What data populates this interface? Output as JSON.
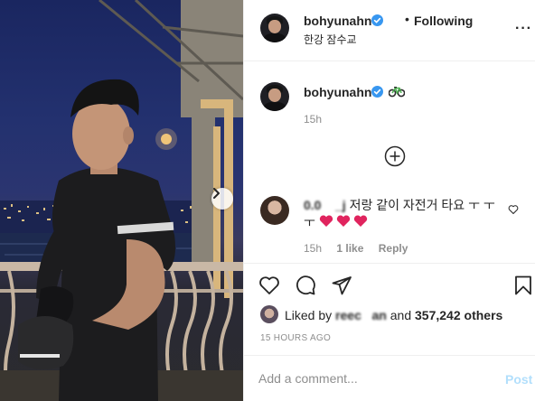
{
  "post": {
    "photo_alt": "",
    "next_icon": "chevron-right-icon"
  },
  "header": {
    "username": "bohyunahn",
    "separator": "•",
    "follow_status": "Following",
    "location": "한강 잠수교",
    "more_icon": "ellipsis-icon",
    "more_label": "···"
  },
  "caption": {
    "username": "bohyunahn",
    "emoji_icon": "bicycle-icon",
    "time": "15h"
  },
  "load_more_icon": "plus-circle-icon",
  "comment": {
    "username": "0.0    _j",
    "text": " 저랑 같이 자전거 타요 ㅜ ㅜㅜ",
    "hearts_icon": "red-heart-emoji",
    "time": "15h",
    "likes": "1 like",
    "reply": "Reply"
  },
  "actions": {
    "like_icon": "heart-icon",
    "comment_icon": "comment-icon",
    "share_icon": "paper-plane-icon",
    "save_icon": "bookmark-icon"
  },
  "likes": {
    "prefix": "Liked by ",
    "user": "reec   an",
    "and": " and ",
    "others": "357,242 others"
  },
  "date": "15 HOURS AGO",
  "comment_box": {
    "placeholder": "Add a comment...",
    "post_label": "Post"
  },
  "colors": {
    "verified": "#3897f0",
    "heart": "#ed4956",
    "post_disabled": "#b2dffc",
    "muted": "#8e8e8e"
  }
}
